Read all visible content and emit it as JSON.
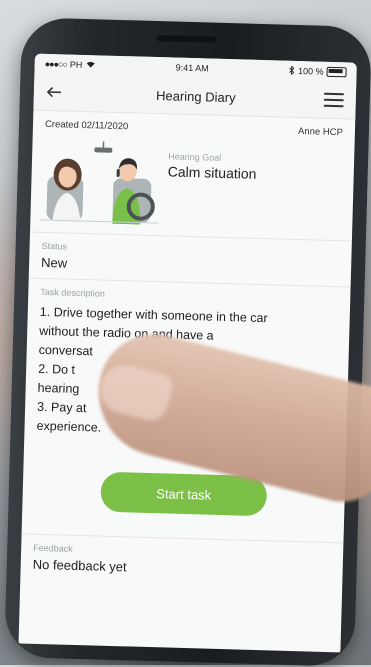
{
  "status_bar": {
    "carrier": "PH",
    "time": "9:41 AM",
    "battery": "100 %"
  },
  "nav": {
    "title": "Hearing Diary"
  },
  "meta": {
    "created": "Created 02/11/2020",
    "owner": "Anne HCP"
  },
  "goal": {
    "label": "Hearing Goal",
    "value": "Calm situation"
  },
  "status": {
    "label": "Status",
    "value": "New"
  },
  "task": {
    "label": "Task description",
    "lines": [
      "1. Drive together with someone in the car",
      "without the radio on and have a",
      "conversat",
      "2. Do t",
      "hearing",
      "3. Pay at",
      "experience."
    ]
  },
  "actions": {
    "start_label": "Start task"
  },
  "feedback": {
    "label": "Feedback",
    "value": "No feedback yet"
  },
  "colors": {
    "accent": "#7cc048"
  },
  "icons": {
    "back": "back-arrow-icon",
    "menu": "hamburger-menu-icon",
    "wifi": "wifi-icon",
    "bluetooth": "bluetooth-icon",
    "battery": "battery-icon"
  }
}
